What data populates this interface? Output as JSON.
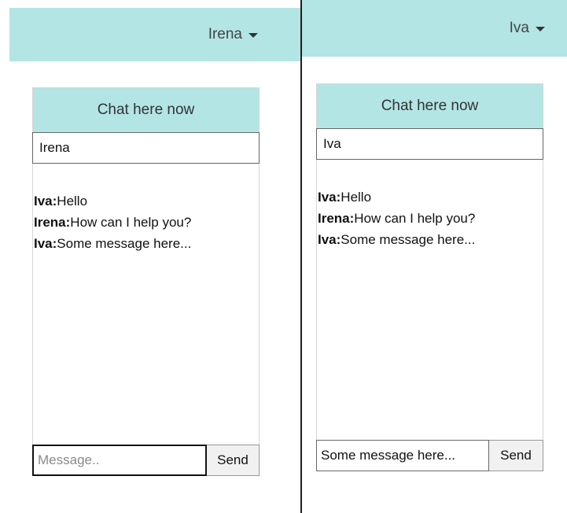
{
  "colors": {
    "accent": "#b3e5e5",
    "divider": "#1f1f1f"
  },
  "left_window": {
    "user_menu": {
      "label": "Irena",
      "icon": "caret-down-icon"
    },
    "chat": {
      "header": "Chat here now",
      "name_value": "Irena",
      "messages": [
        {
          "author": "Iva:",
          "text": "Hello"
        },
        {
          "author": "Irena:",
          "text": "How can I help you?"
        },
        {
          "author": "Iva:",
          "text": "Some message here..."
        }
      ],
      "message_value": "",
      "message_placeholder": "Message..",
      "send_label": "Send"
    }
  },
  "right_window": {
    "user_menu": {
      "label": "Iva",
      "icon": "caret-down-icon"
    },
    "chat": {
      "header": "Chat here now",
      "name_value": "Iva",
      "messages": [
        {
          "author": "Iva:",
          "text": "Hello"
        },
        {
          "author": "Irena:",
          "text": "How can I help you?"
        },
        {
          "author": "Iva:",
          "text": "Some message here..."
        }
      ],
      "message_value": "Some message here...",
      "message_placeholder": "Message..",
      "send_label": "Send"
    }
  }
}
